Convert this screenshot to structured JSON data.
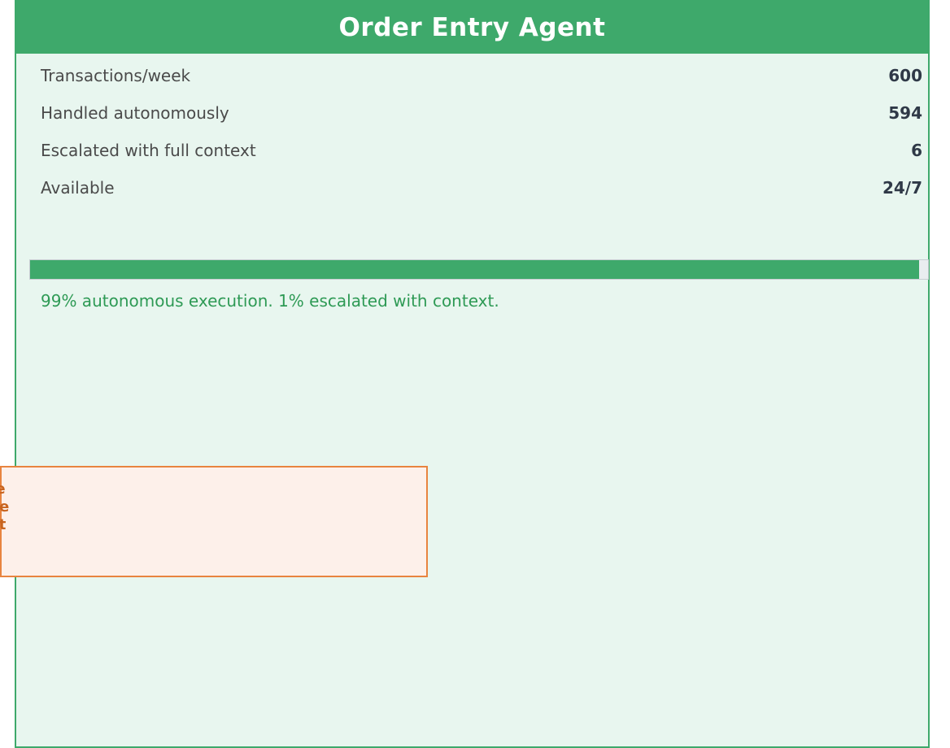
{
  "panel": {
    "title": "Order Entry Agent",
    "stats": [
      {
        "label": "Transactions/week",
        "value": "600"
      },
      {
        "label": "Handled autonomously",
        "value": "594"
      },
      {
        "label": "Escalated with full context",
        "value": "6"
      },
      {
        "label": "Available",
        "value": "24/7"
      }
    ],
    "progress": {
      "percent": 99,
      "caption": "99% autonomous execution. 1% escalated with context."
    }
  },
  "callout": {
    "text": "ould\non be\nth the\nu just\nack?"
  },
  "colors": {
    "accent": "#3ea96b",
    "panel_bg": "#e8f6ef",
    "callout_border": "#e8843f",
    "callout_text": "#c8641f"
  }
}
